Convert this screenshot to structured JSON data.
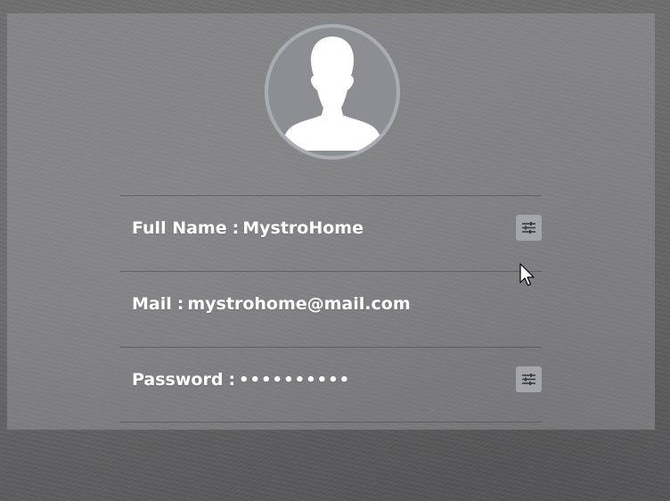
{
  "profile": {
    "avatar_icon": "user-silhouette-icon",
    "fields": [
      {
        "label": "Full Name",
        "separator": ":",
        "value": "MystroHome",
        "editable": true,
        "edit_icon": "sliders-icon"
      },
      {
        "label": "Mail",
        "separator": ":",
        "value": "mystrohome@mail.com",
        "editable": false
      },
      {
        "label": "Password",
        "separator": ":",
        "value": "••••••••••",
        "editable": true,
        "edit_icon": "sliders-icon"
      }
    ]
  },
  "colors": {
    "panel": "#a0a0a3",
    "avatar_ring": "#a9adb3",
    "text": "#ffffff",
    "button": "#a5a6aa"
  }
}
